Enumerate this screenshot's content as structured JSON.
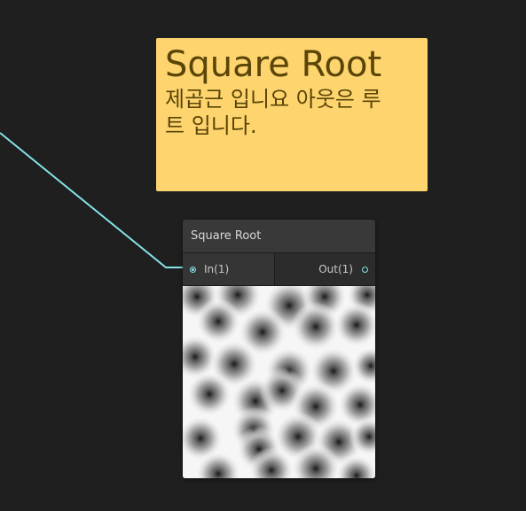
{
  "sticky_note": {
    "title": "Square Root",
    "body": "제곱근 입니요 아웃은 루트 입니다.",
    "color": "#fdd46e",
    "text_color": "#5a4406"
  },
  "node": {
    "title": "Square Root",
    "input_label": "In(1)",
    "output_label": "Out(1)",
    "port_color": "#84e4e7",
    "preview_icon": "voronoi-preview-image"
  },
  "colors": {
    "background": "#1f1f1f",
    "wire": "#84e4e7"
  }
}
